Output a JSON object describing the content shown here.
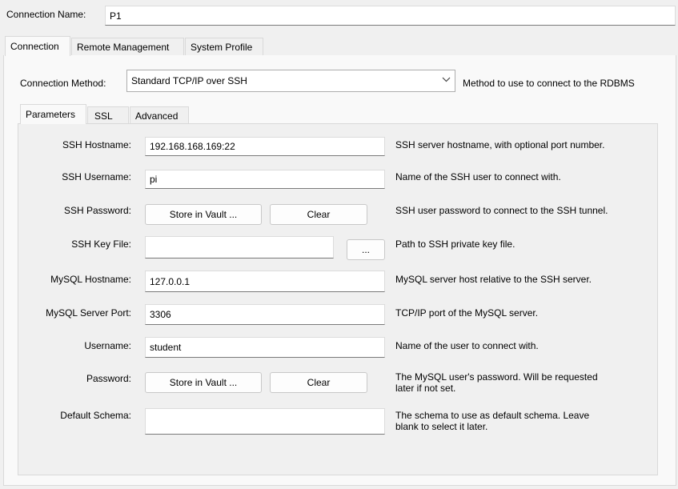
{
  "connection_name": {
    "label": "Connection Name:",
    "value": "P1"
  },
  "top_tabs": [
    {
      "label": "Connection"
    },
    {
      "label": "Remote Management"
    },
    {
      "label": "System Profile"
    }
  ],
  "method": {
    "label": "Connection Method:",
    "value": "Standard TCP/IP over SSH",
    "description": "Method to use to connect to the RDBMS"
  },
  "sub_tabs": [
    {
      "label": "Parameters"
    },
    {
      "label": "SSL"
    },
    {
      "label": "Advanced"
    }
  ],
  "fields": {
    "ssh_hostname": {
      "label": "SSH Hostname:",
      "value": "192.168.168.169:22",
      "description": "SSH server hostname, with  optional port number."
    },
    "ssh_username": {
      "label": "SSH Username:",
      "value": "pi",
      "description": "Name of the SSH user to connect with."
    },
    "ssh_password": {
      "label": "SSH Password:",
      "store_label": "Store in Vault ...",
      "clear_label": "Clear",
      "description": "SSH user password to connect to the SSH tunnel."
    },
    "ssh_key_file": {
      "label": "SSH Key File:",
      "value": "",
      "browse_label": "...",
      "description": "Path to SSH private key file."
    },
    "mysql_hostname": {
      "label": "MySQL Hostname:",
      "value": "127.0.0.1",
      "description": "MySQL server host relative to the SSH server."
    },
    "mysql_port": {
      "label": "MySQL Server Port:",
      "value": "3306",
      "description": "TCP/IP port of the MySQL server."
    },
    "username": {
      "label": "Username:",
      "value": "student",
      "description": "Name of the user to connect with."
    },
    "password": {
      "label": "Password:",
      "store_label": "Store in Vault ...",
      "clear_label": "Clear",
      "description_line1": "The MySQL user's password. Will be requested",
      "description_line2": "later if not set."
    },
    "default_schema": {
      "label": "Default Schema:",
      "value": "",
      "description_line1": "The schema to use as default schema. Leave",
      "description_line2": "blank to select it later."
    }
  },
  "icons": {
    "dropdown": "chevron-down-icon"
  }
}
